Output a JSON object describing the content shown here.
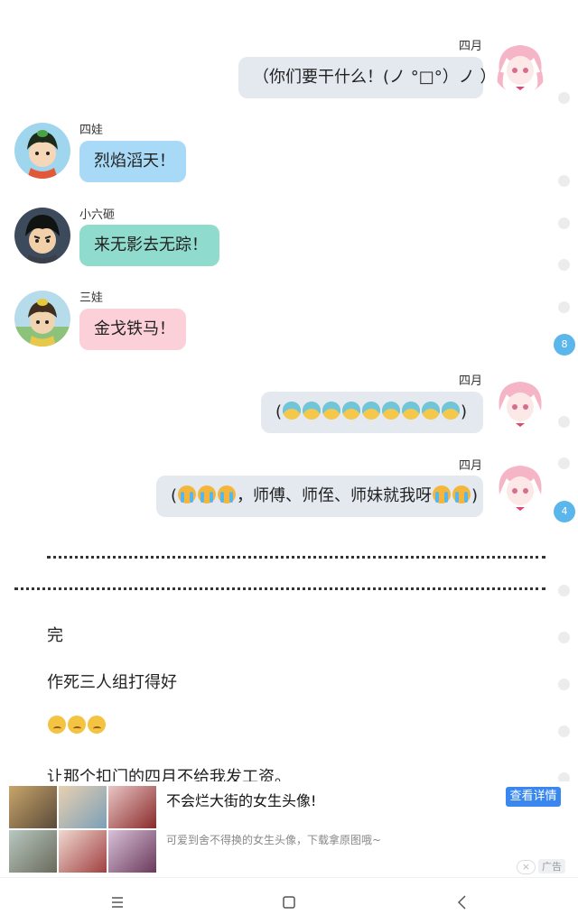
{
  "messages": [
    {
      "side": "right",
      "name": "四月",
      "text": "（你们要干什么！(ノ °□°）ノ ）",
      "emoji": []
    },
    {
      "side": "left",
      "name": "四娃",
      "text": "烈焰滔天！",
      "style": "blue"
    },
    {
      "side": "left",
      "name": "小六砸",
      "text": "来无影去无踪！",
      "style": "teal"
    },
    {
      "side": "left",
      "name": "三娃",
      "text": "金戈铁马！",
      "style": "pink"
    },
    {
      "side": "right",
      "name": "四月",
      "text_prefix": "(",
      "text_suffix": ")",
      "emoji": [
        "fear-face",
        "fear-face",
        "fear-face",
        "fear-face",
        "fear-face",
        "fear-face",
        "fear-face",
        "fear-face",
        "fear-face"
      ]
    },
    {
      "side": "right",
      "name": "四月",
      "text_prefix": "(",
      "text_middle": "，师傅、师侄、师妹就我呀",
      "text_suffix": ")"
    }
  ],
  "badges": [
    "8",
    "4"
  ],
  "paragraphs": {
    "p1": "完",
    "p2": "作死三人组打得好",
    "p4": "让那个扣门的四月不给我发工资。"
  },
  "ad": {
    "title": "不会烂大街的女生头像!",
    "subtitle": "可爱到舍不得换的女生头像，下载拿原图哦~",
    "button": "查看详情",
    "tag": "广告",
    "close": "×"
  },
  "nav": {
    "menu_icon": "menu-icon",
    "home_icon": "home-icon",
    "back_icon": "back-icon"
  }
}
